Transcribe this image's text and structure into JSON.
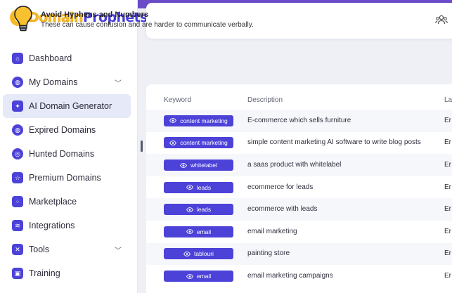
{
  "brand": {
    "name_part1": "Domain",
    "name_part2": "Prophets"
  },
  "sidebar": {
    "items": [
      {
        "label": "Dashboard"
      },
      {
        "label": "My Domains"
      },
      {
        "label": "AI Domain Generator"
      },
      {
        "label": "Expired Domains"
      },
      {
        "label": "Hunted Domains"
      },
      {
        "label": "Premium Domains"
      },
      {
        "label": "Marketplace"
      },
      {
        "label": "Integrations"
      },
      {
        "label": "Tools"
      },
      {
        "label": "Training"
      }
    ],
    "active_item": "AI Domain Generator"
  },
  "tip": {
    "title": "Avoid Hyphens and Numbers",
    "text": "These can cause confusion and are harder to communicate verbally."
  },
  "table": {
    "columns": [
      "Keyword",
      "Description",
      "La"
    ],
    "rows": [
      {
        "keyword": "content marketing",
        "description": "E-commerce which sells furniture",
        "lang": "Er"
      },
      {
        "keyword": "content marketing",
        "description": "simple content marketing AI software to write blog posts",
        "lang": "Er"
      },
      {
        "keyword": "whitelabel",
        "description": "a saas product with whitelabel",
        "lang": "Er"
      },
      {
        "keyword": "leads",
        "description": "ecommerce for leads",
        "lang": "Er"
      },
      {
        "keyword": "leads",
        "description": "ecommerce with leads",
        "lang": "Er"
      },
      {
        "keyword": "email",
        "description": "email marketing",
        "lang": "Er"
      },
      {
        "keyword": "tablouri",
        "description": "painting store",
        "lang": "Er"
      },
      {
        "keyword": "email",
        "description": "email marketing campaigns",
        "lang": "Er"
      }
    ]
  },
  "colors": {
    "accent": "#4c42d8",
    "brand_yellow": "#f6b926",
    "top_bar": "#6a4cc9"
  }
}
